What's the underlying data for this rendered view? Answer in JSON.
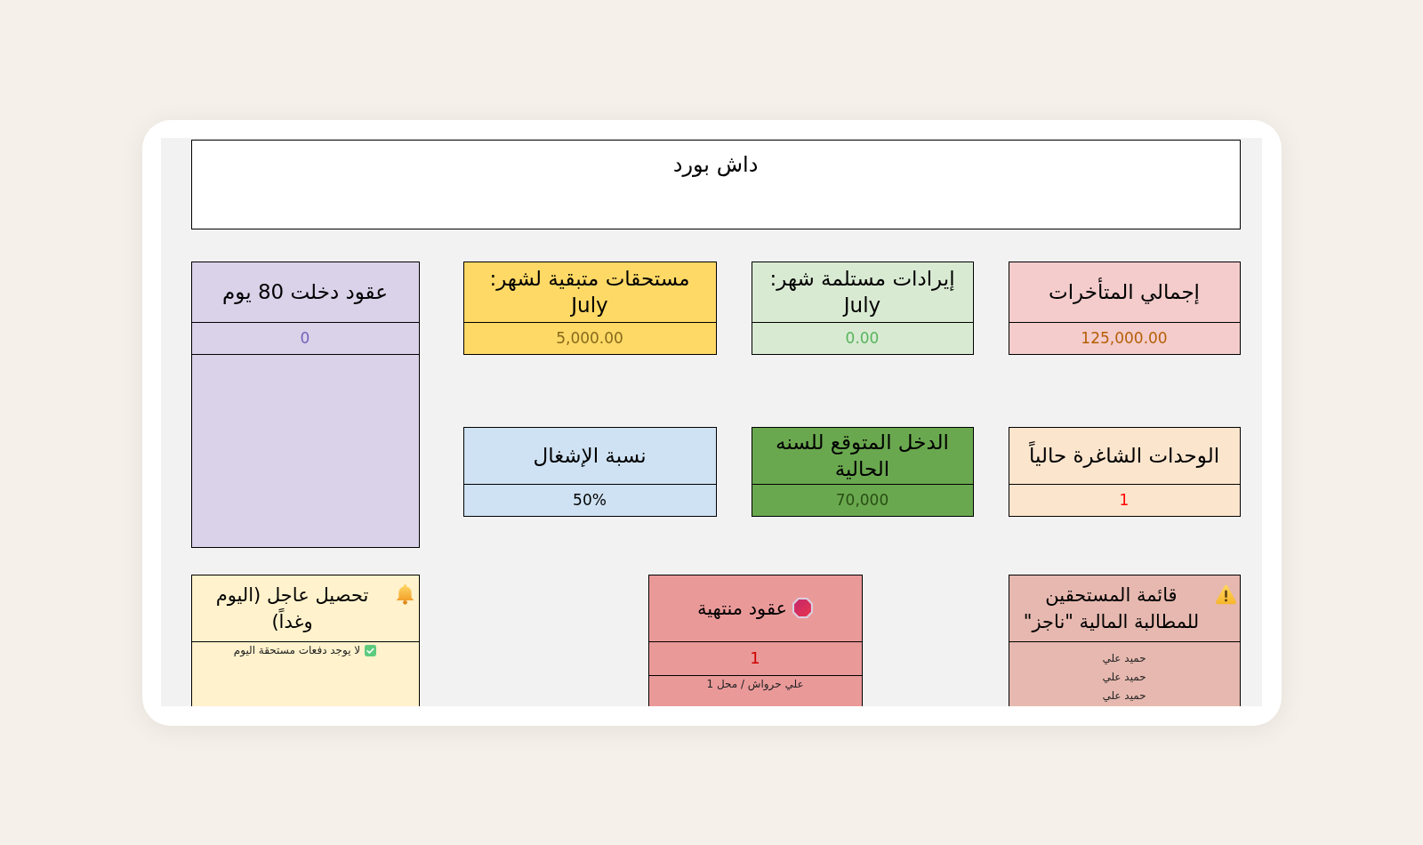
{
  "header": {
    "title": "داش بورد"
  },
  "top_cards": [
    {
      "title": "إجمالي المتأخرات",
      "value": "125,000.00",
      "color": "#f4cccc"
    },
    {
      "title": "إيرادات مستلمة شهر: July",
      "value": "0.00",
      "color": "#d9ead3"
    },
    {
      "title": "مستحقات متبقية لشهر: July",
      "value": "5,000.00",
      "color": "#ffd966"
    }
  ],
  "contracts_80_days": {
    "title": "عقود دخلت 80 يوم",
    "value": "0",
    "color": "#d9d2e9"
  },
  "middle_cards": [
    {
      "title": "الوحدات الشاغرة حالياً",
      "value": "1",
      "color": "#fce5cd"
    },
    {
      "title": "الدخل المتوقع للسنه الحالية",
      "value": "70,000",
      "color": "#6aa84f"
    },
    {
      "title": "نسبة الإشغال",
      "value": "50%",
      "color": "#cfe2f3"
    }
  ],
  "panels": [
    {
      "kind": "claims",
      "title": "قائمة المستحقين للمطالبة المالية \"ناجز\"",
      "color": "#e6b8af",
      "items": [
        {
          "kind": "entry",
          "text": "حميد علي"
        },
        {
          "kind": "entry",
          "text": "حميد علي"
        },
        {
          "kind": "entry",
          "text": "حميد علي"
        }
      ]
    },
    {
      "kind": "expired",
      "title": "عقود منتهية",
      "value": "1",
      "color": "#ea9999",
      "items": [
        {
          "kind": "entry",
          "text": "علي حرواش / محل 1"
        }
      ]
    },
    {
      "kind": "urgent",
      "title": "تحصيل عاجل (اليوم وغداً)",
      "color": "#fff2cc",
      "items": [
        {
          "kind": "notice",
          "text": "لا يوجد دفعات مستحقة اليوم"
        }
      ]
    }
  ]
}
